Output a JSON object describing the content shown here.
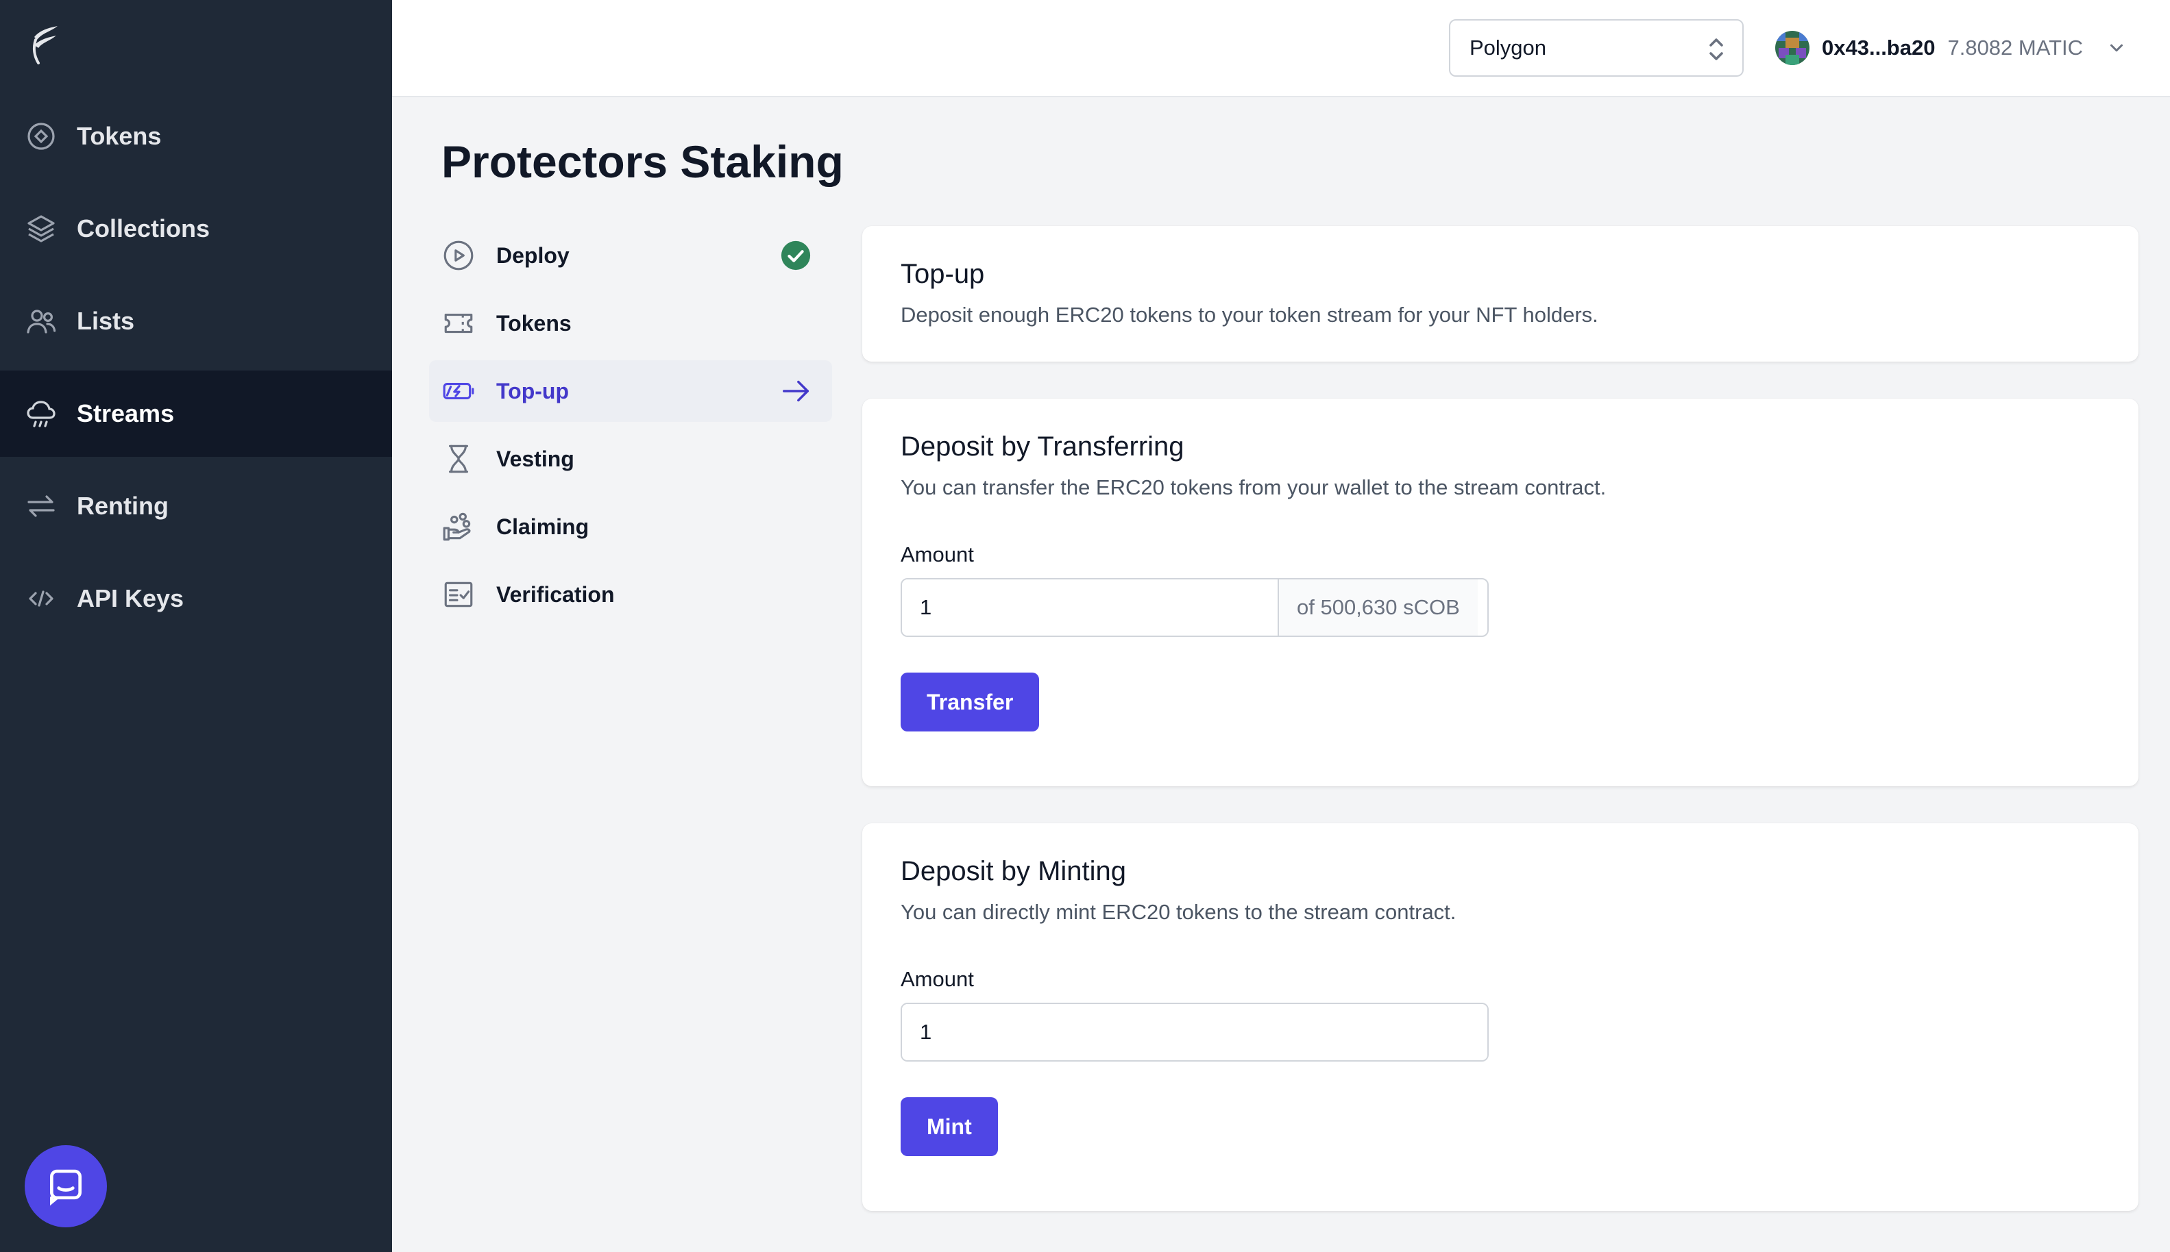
{
  "sidebar": {
    "items": [
      {
        "label": "Tokens",
        "icon": "token-icon"
      },
      {
        "label": "Collections",
        "icon": "layers-icon"
      },
      {
        "label": "Lists",
        "icon": "users-icon"
      },
      {
        "label": "Streams",
        "icon": "cloud-rain-icon",
        "active": true
      },
      {
        "label": "Renting",
        "icon": "arrows-swap-icon"
      },
      {
        "label": "API Keys",
        "icon": "code-icon"
      }
    ]
  },
  "header": {
    "network": "Polygon",
    "wallet_address": "0x43...ba20",
    "wallet_balance": "7.8082 MATIC"
  },
  "page": {
    "title": "Protectors Staking"
  },
  "steps": [
    {
      "label": "Deploy",
      "icon": "play-circle-icon",
      "status": "complete"
    },
    {
      "label": "Tokens",
      "icon": "ticket-icon"
    },
    {
      "label": "Top-up",
      "icon": "battery-charge-icon",
      "status": "current"
    },
    {
      "label": "Vesting",
      "icon": "hourglass-icon"
    },
    {
      "label": "Claiming",
      "icon": "hand-coins-icon"
    },
    {
      "label": "Verification",
      "icon": "checklist-icon"
    }
  ],
  "topup": {
    "title": "Top-up",
    "description": "Deposit enough ERC20 tokens to your token stream for your NFT holders."
  },
  "transfer": {
    "title": "Deposit by Transferring",
    "description": "You can transfer the ERC20 tokens from your wallet to the stream contract.",
    "amount_label": "Amount",
    "amount_value": "1",
    "balance_addon": "of 500,630 sCOB",
    "button_label": "Transfer"
  },
  "mint": {
    "title": "Deposit by Minting",
    "description": "You can directly mint ERC20 tokens to the stream contract.",
    "amount_label": "Amount",
    "amount_value": "1",
    "button_label": "Mint"
  },
  "colors": {
    "sidebar_bg": "#1f2937",
    "sidebar_active": "#111827",
    "accent": "#4f46e5",
    "success": "#2f855a"
  }
}
